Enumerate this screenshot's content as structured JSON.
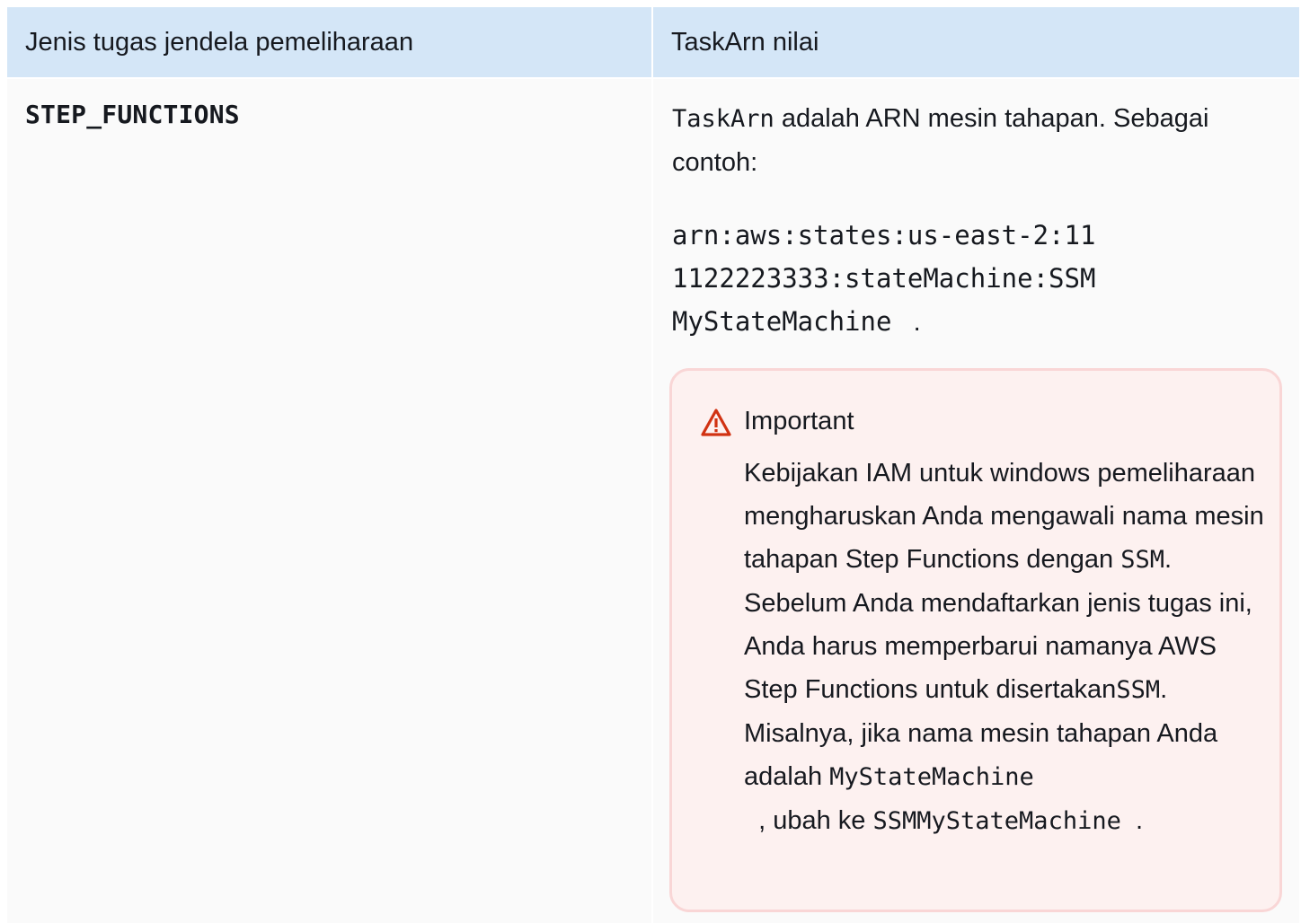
{
  "table": {
    "headers": [
      "Jenis tugas jendela pemeliharaan",
      "TaskArn nilai"
    ],
    "row": {
      "task_type": "STEP_FUNCTIONS",
      "desc_code": "TaskArn",
      "desc_text": " adalah ARN mesin tahapan. Sebagai contoh:",
      "arn_lines": [
        "arn:aws:states:us-east-2:11",
        "1122223333:stateMachine:SSM",
        "MyStateMachine"
      ],
      "arn_suffix": "   .",
      "callout": {
        "title": "Important",
        "icon": "warning-triangle-icon",
        "body_part1": "Kebijakan IAM untuk windows pemeliharaan mengharuskan Anda mengawali nama mesin tahapan Step Functions dengan ",
        "code1": "SSM",
        "body_part2": ". Sebelum Anda mendaftarkan jenis tugas ini, Anda harus memperbarui namanya AWS Step Functions untuk disertakan",
        "code2": "SSM",
        "body_part3": ". Misalnya, jika nama mesin tahapan Anda adalah ",
        "code3": "MyStateMachine",
        "body_part4": "  , ubah ke ",
        "code4": "SSMMyStateMachine",
        "body_part5": "  ."
      }
    }
  },
  "colors": {
    "header_bg": "#d4e6f7",
    "cell_bg": "#fafafa",
    "callout_bg": "#fdf1f0",
    "callout_border": "#f9d6d6",
    "warning_red": "#d13212"
  }
}
